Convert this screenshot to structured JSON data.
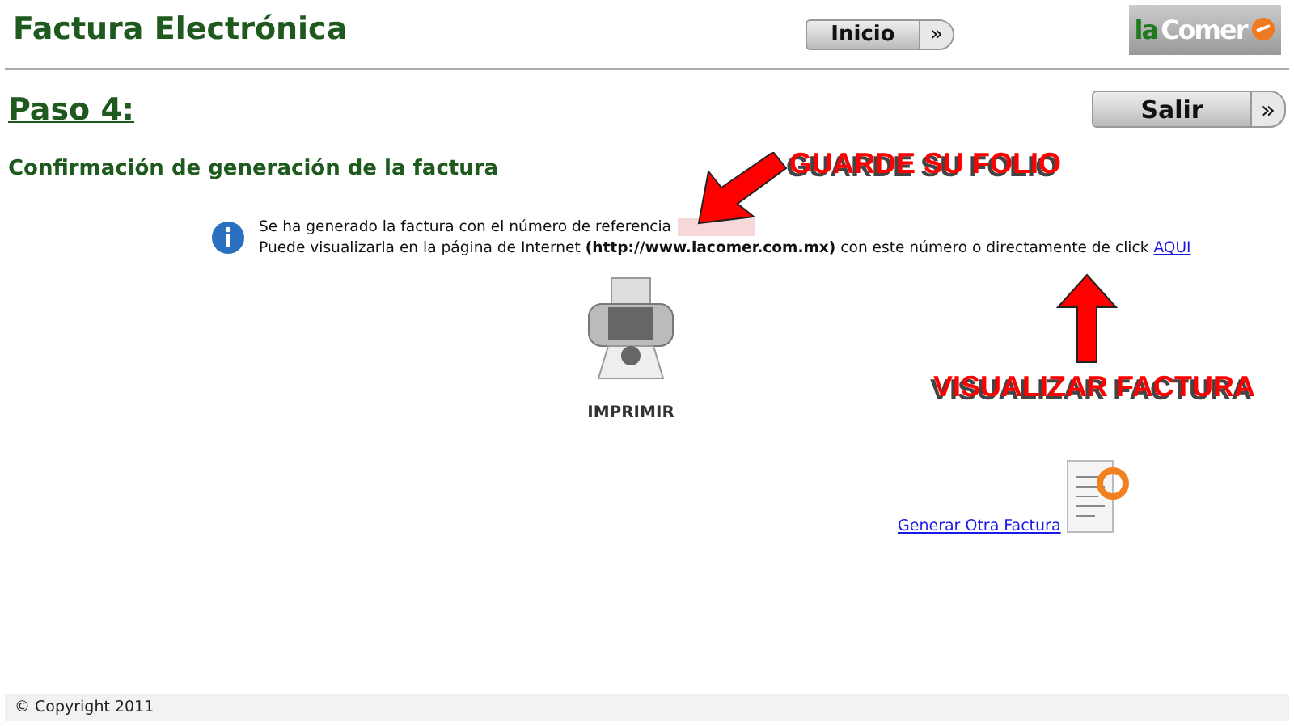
{
  "header": {
    "title": "Factura Electrónica",
    "home_button": "Inicio",
    "button_chevron": "»",
    "logo": {
      "text_left": "la",
      "text_right": "Comer"
    }
  },
  "step": {
    "title": "Paso 4:",
    "exit_button": "Salir",
    "button_chevron": "»"
  },
  "subtitle": "Confirmación de generación de la factura",
  "info": {
    "line1": "Se ha generado la factura con el número de referencia",
    "reference_redacted": true,
    "line2_before": "Puede visualizarla en la página de Internet",
    "line2_url": "(http://www.lacomer.com.mx)",
    "line2_after": "con este número o directamente de click",
    "link": "AQUI"
  },
  "print": {
    "label": "IMPRIMIR"
  },
  "new_invoice_link": "Generar Otra Factura",
  "annotations": [
    {
      "kind": "arrow_down_left",
      "text": "GUARDE SU FOLIO"
    },
    {
      "kind": "arrow_up",
      "text": "VISUALIZAR FACTURA"
    }
  ],
  "footer": "© Copyright 2011"
}
